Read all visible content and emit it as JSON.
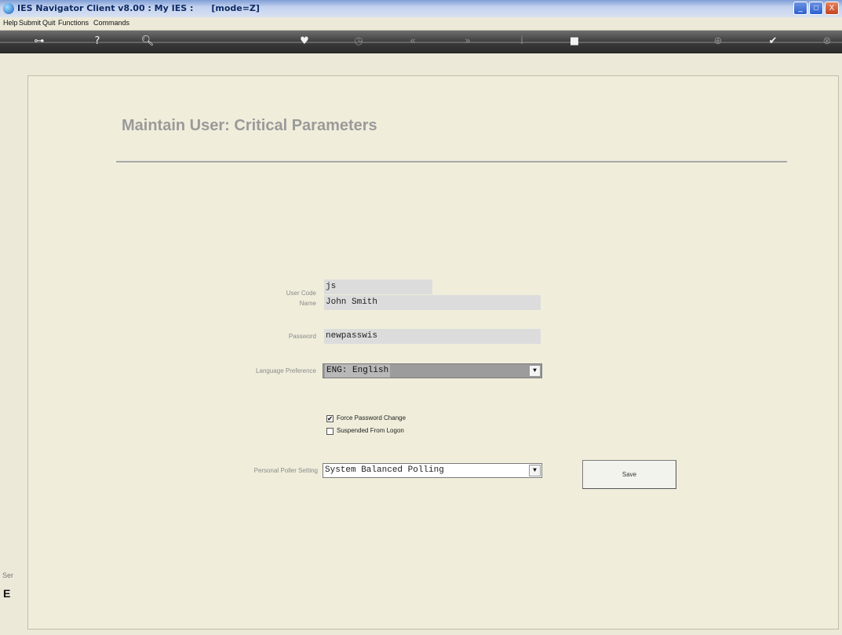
{
  "window": {
    "title": "IES Navigator Client v8.00 : My IES :      [mode=Z]",
    "controls": [
      "_",
      "□",
      "X"
    ]
  },
  "menubar": {
    "items": [
      "Help",
      "Submit",
      "Quit",
      "Functions",
      "Commands"
    ]
  },
  "toolbar": {
    "icons": [
      {
        "name": "key-icon",
        "glyph": "⊶",
        "dim": false
      },
      {
        "name": "help-icon",
        "glyph": "?",
        "dim": false
      },
      {
        "name": "search-icon",
        "glyph": "🔍︎",
        "dim": false
      },
      {
        "name": "heart-icon",
        "glyph": "♥",
        "dim": false
      },
      {
        "name": "history-icon",
        "glyph": "◷",
        "dim": true
      },
      {
        "name": "back-icon",
        "glyph": "«",
        "dim": true
      },
      {
        "name": "forward-icon",
        "glyph": "»",
        "dim": true
      },
      {
        "name": "info-icon",
        "glyph": "i",
        "dim": true
      },
      {
        "name": "stop-icon",
        "glyph": "■",
        "dim": false
      },
      {
        "name": "add-icon",
        "glyph": "⊕",
        "dim": true
      },
      {
        "name": "ok-icon",
        "glyph": "✔",
        "dim": false
      },
      {
        "name": "cancel-icon",
        "glyph": "⊗",
        "dim": true
      }
    ]
  },
  "side": {
    "ser_text": "Ser",
    "e_char": "E"
  },
  "page": {
    "title": "Maintain User: Critical Parameters"
  },
  "form": {
    "user_code_label": "User Code",
    "user_code_value": "js",
    "name_label": "Name",
    "name_value": "John Smith",
    "password_label": "Password",
    "password_value": "newpasswis",
    "language_label": "Language Preference",
    "language_value": "ENG: English",
    "force_password_label": "Force Password Change",
    "force_password_checked": true,
    "suspended_label": "Suspended From Logon",
    "suspended_checked": false,
    "poller_label": "Personal Poller Setting",
    "poller_value": "System Balanced Polling",
    "save_label": "Save",
    "check_mark": "✔",
    "dropdown_glyph": "▼"
  }
}
